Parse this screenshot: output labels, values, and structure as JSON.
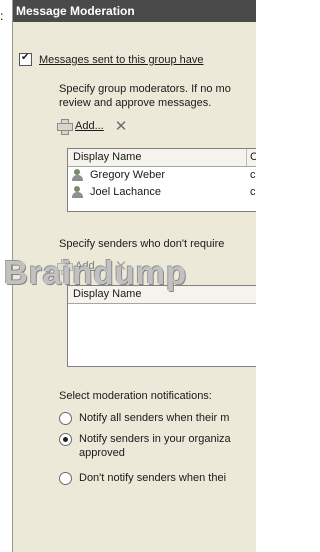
{
  "stray_char": ":",
  "title": "Message Moderation",
  "moderation_checkbox": {
    "label": "Messages sent to this group have",
    "checked": true
  },
  "moderators": {
    "description": "Specify group moderators. If no mo review and approve messages.",
    "add_label": "Add...",
    "remove_icon": "remove-x-icon",
    "columns": [
      "Display Name",
      "C"
    ],
    "rows": [
      {
        "name": "Gregory Weber",
        "col2": "c"
      },
      {
        "name": "Joel Lachance",
        "col2": "c"
      }
    ]
  },
  "senders": {
    "description": "Specify senders who don't require",
    "add_label": "Add...",
    "column": "Display Name"
  },
  "notifications": {
    "label": "Select moderation notifications:",
    "options": [
      {
        "label": "Notify all senders when their m",
        "selected": false
      },
      {
        "label": "Notify senders in your organiza",
        "label2": "approved",
        "selected": true
      },
      {
        "label": "Don't notify senders when thei",
        "selected": false
      }
    ]
  },
  "watermark": "Braindump",
  "colors": {
    "titlebar": "#4a4a4a",
    "panel": "#ece9d8"
  }
}
